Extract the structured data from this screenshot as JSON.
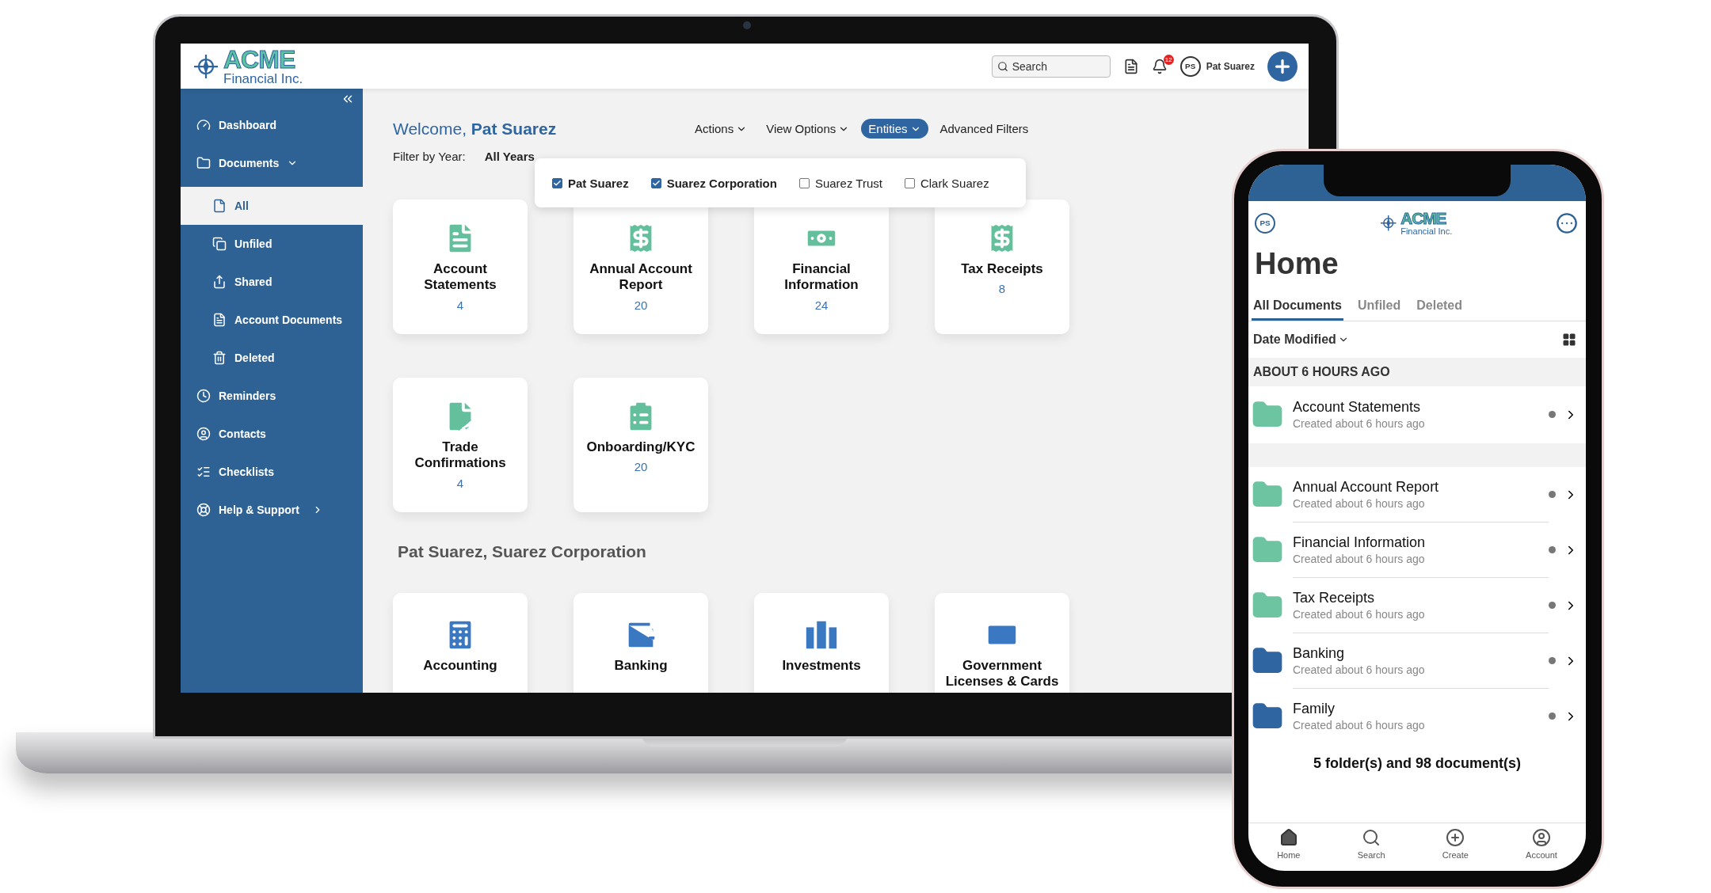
{
  "laptop": {
    "header": {
      "logo": {
        "name": "ACME",
        "tagline": "Financial Inc."
      },
      "search": {
        "placeholder": "Search"
      },
      "notification_count": "12",
      "user": {
        "initials": "PS",
        "name": "Pat Suarez"
      }
    },
    "sidebar": {
      "items": [
        {
          "label": "Dashboard",
          "selected": false
        },
        {
          "label": "Documents",
          "selected": false,
          "expanded": true,
          "children": [
            {
              "label": "All",
              "selected": true
            },
            {
              "label": "Unfiled",
              "selected": false
            },
            {
              "label": "Shared",
              "selected": false
            },
            {
              "label": "Account Documents",
              "selected": false
            },
            {
              "label": "Deleted",
              "selected": false
            }
          ]
        },
        {
          "label": "Reminders",
          "selected": false
        },
        {
          "label": "Contacts",
          "selected": false
        },
        {
          "label": "Checklists",
          "selected": false
        },
        {
          "label": "Help & Support",
          "selected": false,
          "expanded": false
        }
      ]
    },
    "welcome": {
      "greeting": "Welcome,",
      "name": "Pat Suarez"
    },
    "toolbar": [
      {
        "label": "Actions",
        "selected": false,
        "dropdown": true
      },
      {
        "label": "View Options",
        "selected": false,
        "dropdown": true
      },
      {
        "label": "Entities",
        "selected": true,
        "dropdown": true
      },
      {
        "label": "Advanced Filters",
        "selected": false,
        "dropdown": false
      }
    ],
    "filter": {
      "label": "Filter by Year:",
      "value": "All Years"
    },
    "entities": [
      {
        "label": "Pat Suarez",
        "checked": true
      },
      {
        "label": "Suarez Corporation",
        "checked": true
      },
      {
        "label": "Suarez Trust",
        "checked": false
      },
      {
        "label": "Clark Suarez",
        "checked": false
      }
    ],
    "cards": [
      {
        "title": "Account Statements",
        "count": "4"
      },
      {
        "title": "Annual Account Report",
        "count": "20"
      },
      {
        "title": "Financial Information",
        "count": "24"
      },
      {
        "title": "Tax Receipts",
        "count": "8"
      },
      {
        "title": "Trade Confirmations",
        "count": "4"
      },
      {
        "title": "Onboarding/KYC",
        "count": "20"
      }
    ],
    "section": {
      "title": "Pat Suarez, Suarez Corporation",
      "cards": [
        {
          "title": "Accounting"
        },
        {
          "title": "Banking"
        },
        {
          "title": "Investments"
        },
        {
          "title": "Government Licenses & Cards"
        }
      ]
    }
  },
  "phone": {
    "avatar": "PS",
    "logo": {
      "name": "ACME",
      "tagline": "Financial Inc."
    },
    "title": "Home",
    "tabs": [
      {
        "label": "All Documents",
        "selected": true
      },
      {
        "label": "Unfiled",
        "selected": false
      },
      {
        "label": "Deleted",
        "selected": false
      }
    ],
    "sort": "Date Modified",
    "group": "ABOUT 6 HOURS AGO",
    "folders": [
      {
        "name": "Account Statements",
        "subtitle": "Created about 6 hours ago",
        "color": "#6cc4a1"
      },
      {
        "name": "Annual Account Report",
        "subtitle": "Created about 6 hours ago",
        "color": "#6cc4a1"
      },
      {
        "name": "Financial Information",
        "subtitle": "Created about 6 hours ago",
        "color": "#6cc4a1"
      },
      {
        "name": "Tax Receipts",
        "subtitle": "Created about 6 hours ago",
        "color": "#6cc4a1"
      },
      {
        "name": "Banking",
        "subtitle": "Created about 6 hours ago",
        "color": "#2f65a0"
      },
      {
        "name": "Family",
        "subtitle": "Created about 6 hours ago",
        "color": "#2f65a0"
      }
    ],
    "summary": "5 folder(s) and 98 document(s)",
    "nav": [
      {
        "label": "Home",
        "selected": true
      },
      {
        "label": "Search",
        "selected": false
      },
      {
        "label": "Create",
        "selected": false
      },
      {
        "label": "Account",
        "selected": false
      }
    ]
  }
}
